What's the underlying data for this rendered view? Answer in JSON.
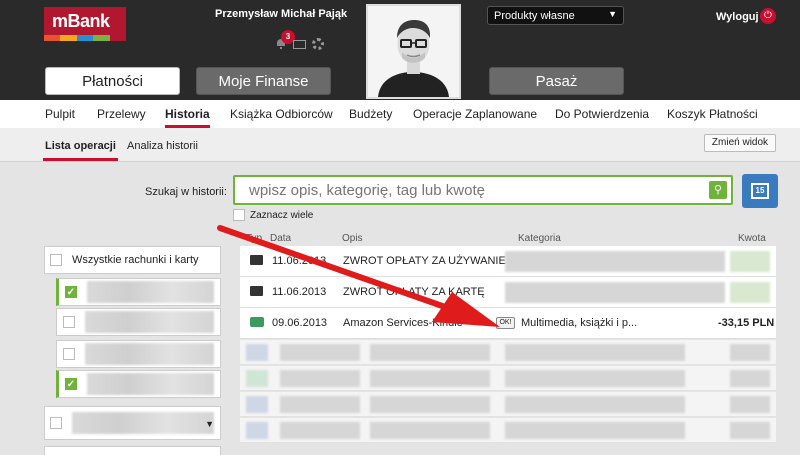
{
  "logo": {
    "text": "mBank"
  },
  "user": {
    "name": "Przemysław Michał Pająk",
    "notifications": "3"
  },
  "products_select": "Produkty własne",
  "logout": "Wyloguj",
  "main_tabs": [
    "Płatności",
    "Moje Finanse",
    "Pasaż"
  ],
  "nav": [
    "Pulpit",
    "Przelewy",
    "Historia",
    "Książka Odbiorców",
    "Budżety",
    "Operacje Zaplanowane",
    "Do Potwierdzenia",
    "Koszyk Płatności"
  ],
  "subtabs": [
    "Lista operacji",
    "Analiza historii"
  ],
  "change_view": "Zmień widok",
  "search": {
    "label": "Szukaj w historii:",
    "placeholder": "wpisz opis, kategorię, tag lub kwotę"
  },
  "calendar_day": "15",
  "multi_select": "Zaznacz wiele",
  "accounts": {
    "all": "Wszystkie rachunki i karty"
  },
  "table": {
    "headers": {
      "typ": "Typ",
      "data": "Data",
      "opis": "Opis",
      "kategoria": "Kategoria",
      "kwota": "Kwota"
    },
    "rows": [
      {
        "date": "11.06.2013",
        "desc": "ZWROT OPŁATY ZA UŻYWANIE K...",
        "category": "",
        "amount": ""
      },
      {
        "date": "11.06.2013",
        "desc": "ZWROT OPŁATY ZA KARTĘ",
        "category": "",
        "amount": ""
      },
      {
        "date": "09.06.2013",
        "desc": "Amazon Services-Kindle",
        "ok": "OK!",
        "category": "Multimedia, książki i p...",
        "amount": "-33,15 PLN"
      }
    ]
  },
  "colors": {
    "brand_red": "#c8102e",
    "green": "#6fb33a",
    "blue": "#3a7bc0",
    "dark": "#2a2a2a"
  }
}
